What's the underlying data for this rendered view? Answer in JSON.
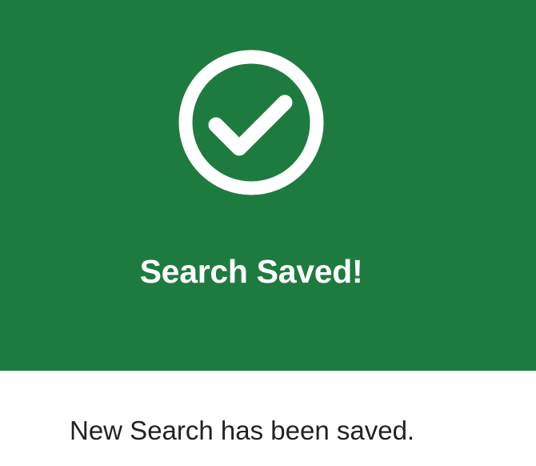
{
  "dialog": {
    "title": "Search Saved!",
    "message": "New Search has been saved.",
    "icon": "check-circle-icon"
  },
  "colors": {
    "banner": "#1e7b40",
    "banner_text": "#ffffff",
    "body_text": "#222222",
    "background": "#ffffff"
  }
}
